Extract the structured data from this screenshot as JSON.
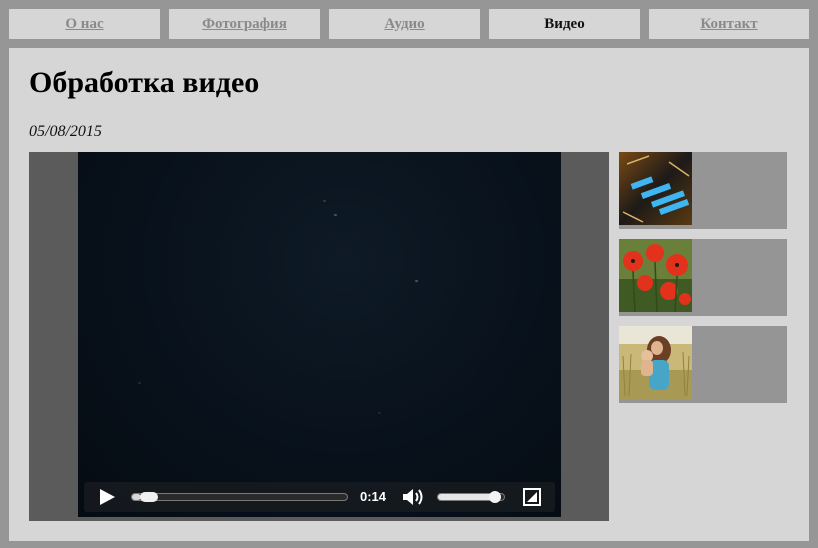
{
  "nav": {
    "tabs": [
      {
        "label": "О нас",
        "active": false
      },
      {
        "label": "Фотография",
        "active": false
      },
      {
        "label": "Аудио",
        "active": false
      },
      {
        "label": "Видео",
        "active": true
      },
      {
        "label": "Контакт",
        "active": false
      }
    ]
  },
  "article": {
    "title": "Обработка видео",
    "date": "05/08/2015"
  },
  "player": {
    "time": "0:14",
    "progress_fraction": 0.04,
    "volume_fraction": 0.95,
    "icons": {
      "play": "play-icon",
      "volume": "volume-icon",
      "fullscreen": "fullscreen-icon"
    }
  },
  "thumbnails": [
    {
      "icon": "circuit-board-photo"
    },
    {
      "icon": "red-poppies-photo"
    },
    {
      "icon": "woman-with-child-in-field-photo"
    }
  ],
  "colors": {
    "page_background": "#969696",
    "panel_background": "#d6d6d6",
    "inactive_tab_text": "#8a8a8a",
    "active_tab_text": "#111111",
    "video_frame": "#5b5b5b"
  }
}
